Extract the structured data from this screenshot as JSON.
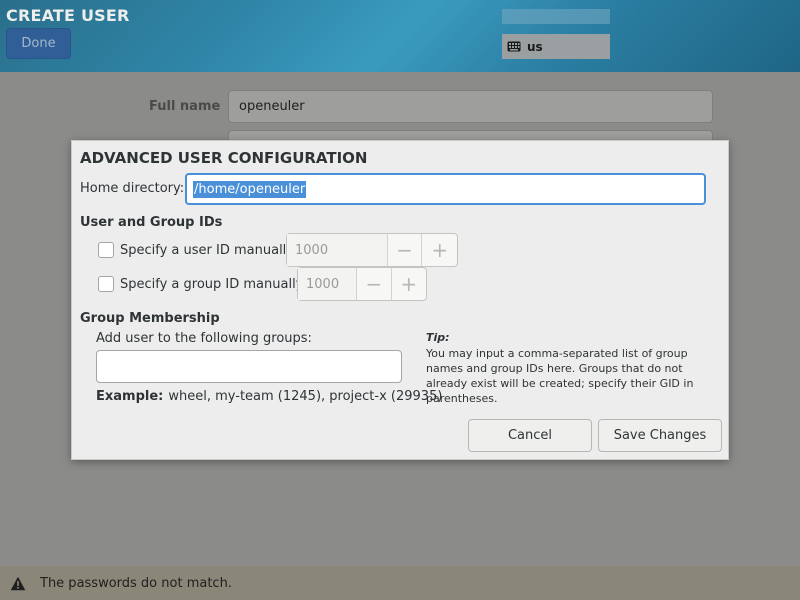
{
  "header": {
    "title": "CREATE USER",
    "done_label": "Done",
    "keyboard_layout": "us"
  },
  "background_form": {
    "full_name_label": "Full name",
    "full_name_value": "openeuler"
  },
  "dialog": {
    "title": "ADVANCED USER CONFIGURATION",
    "home_directory_label": "Home directory:",
    "home_directory_value": "/home/openeuler",
    "ids_section_label": "User and Group IDs",
    "user_id": {
      "label": "Specify a user ID manually:",
      "checked": false,
      "value": "1000"
    },
    "group_id": {
      "label": "Specify a group ID manually:",
      "checked": false,
      "value": "1000"
    },
    "group_section_label": "Group Membership",
    "groups_label": "Add user to the following groups:",
    "groups_value": "",
    "example_label": "Example:",
    "example_text": "wheel, my-team (1245), project-x (29935)",
    "tip_title": "Tip:",
    "tip_text": "You may input a comma-separated list of group names and group IDs here. Groups that do not already exist will be created; specify their GID in parentheses.",
    "cancel_label": "Cancel",
    "save_label": "Save Changes"
  },
  "status": {
    "message": "The passwords do not match."
  },
  "icons": {
    "minus": "−",
    "plus": "+"
  }
}
